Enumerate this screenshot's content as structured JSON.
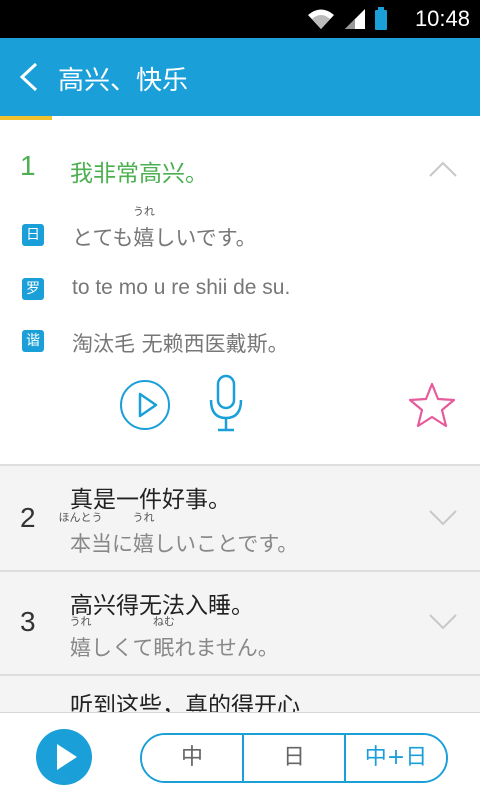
{
  "status": {
    "time": "10:48",
    "icons": [
      "wifi-icon",
      "signal-icon",
      "battery-icon"
    ]
  },
  "app_bar": {
    "title": "高兴、快乐"
  },
  "expanded": {
    "number": "1",
    "chinese": "我非常高兴。",
    "tags": {
      "ja": "日",
      "romaji": "罗",
      "homophone": "谐"
    },
    "japanese_pre": "とても",
    "japanese_kanji": "嬉",
    "japanese_kanji_ruby": "うれ",
    "japanese_post": "しいです。",
    "romaji": "to te mo u re shii de su.",
    "homophone": "淘汰毛 无赖西医戴斯。"
  },
  "rows": [
    {
      "number": "2",
      "chinese": "真是一件好事。",
      "ja_parts": [
        {
          "text": "本",
          "ruby": "ほんとう"
        },
        {
          "text": "当",
          "ruby": ""
        },
        {
          "text": "に",
          "ruby": ""
        },
        {
          "text": "嬉",
          "ruby": "うれ"
        },
        {
          "text": "しいことです。",
          "ruby": ""
        }
      ]
    },
    {
      "number": "3",
      "chinese": "高兴得无法入睡。",
      "ja_parts": [
        {
          "text": "嬉",
          "ruby": "うれ"
        },
        {
          "text": "しくて",
          "ruby": ""
        },
        {
          "text": "眠",
          "ruby": "ねむ"
        },
        {
          "text": "れません。",
          "ruby": ""
        }
      ]
    },
    {
      "number": "",
      "chinese": "听到这些，真的得开心"
    }
  ],
  "bottom": {
    "segments": [
      "中",
      "日",
      "中+日"
    ],
    "selected": "中+日"
  },
  "colors": {
    "primary": "#1a9fd9",
    "green": "#4caf50",
    "accent": "#f2c12e",
    "star": "#e85a9a"
  }
}
